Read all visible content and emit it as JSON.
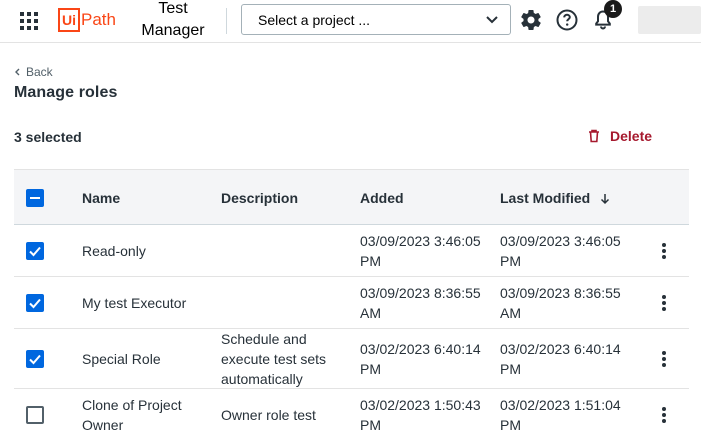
{
  "header": {
    "apps_icon": "apps-grid-icon",
    "logo_ui": "Ui",
    "logo_path": "Path",
    "product_line1": "Test",
    "product_line2": "Manager",
    "project_placeholder": "Select a project ...",
    "notifications_count": "1",
    "colors": {
      "brand": "#fa4616"
    }
  },
  "page": {
    "back_label": "Back",
    "title": "Manage roles",
    "selected_count": "3 selected",
    "delete_label": "Delete",
    "colors": {
      "delete": "#a6192e",
      "checkbox": "#0067df"
    }
  },
  "table": {
    "columns": {
      "name": "Name",
      "description": "Description",
      "added": "Added",
      "last_modified": "Last Modified"
    },
    "header_checkbox_state": "indeterminate",
    "rows": [
      {
        "checked": true,
        "name": "Read-only",
        "description": "",
        "added": "03/09/2023 3:46:05 PM",
        "modified": "03/09/2023 3:46:05 PM"
      },
      {
        "checked": true,
        "name": "My test Executor",
        "description": "",
        "added": "03/09/2023 8:36:55 AM",
        "modified": "03/09/2023 8:36:55 AM"
      },
      {
        "checked": true,
        "name": "Special Role",
        "description": "Schedule and execute test sets automatically",
        "added": "03/02/2023 6:40:14 PM",
        "modified": "03/02/2023 6:40:14 PM"
      },
      {
        "checked": false,
        "name": "Clone of Project Owner",
        "description": "Owner role test",
        "added": "03/02/2023 1:50:43 PM",
        "modified": "03/02/2023 1:51:04 PM"
      }
    ]
  }
}
